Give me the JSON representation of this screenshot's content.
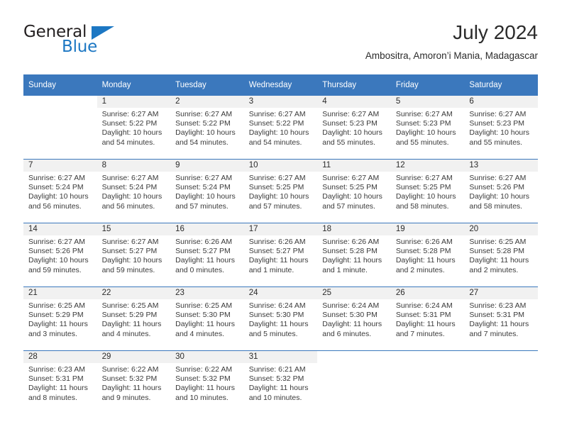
{
  "brand": {
    "word_one": "General",
    "word_two": "Blue",
    "triangle_icon": "brand-triangle-icon",
    "accent_color": "#1c77c3"
  },
  "header": {
    "title": "July 2024",
    "subtitle": "Ambositra, Amoron’i Mania, Madagascar"
  },
  "theme": {
    "header_blue": "#3b78bd",
    "daynum_band": "#f1f1f1",
    "text": "#2b2b2b"
  },
  "weekday_headers": [
    "Sunday",
    "Monday",
    "Tuesday",
    "Wednesday",
    "Thursday",
    "Friday",
    "Saturday"
  ],
  "weeks": [
    [
      {
        "day": "",
        "blank": true,
        "sunrise": "",
        "sunset": "",
        "daylight_line1": "",
        "daylight_line2": ""
      },
      {
        "day": "1",
        "sunrise": "Sunrise: 6:27 AM",
        "sunset": "Sunset: 5:22 PM",
        "daylight_line1": "Daylight: 10 hours",
        "daylight_line2": "and 54 minutes."
      },
      {
        "day": "2",
        "sunrise": "Sunrise: 6:27 AM",
        "sunset": "Sunset: 5:22 PM",
        "daylight_line1": "Daylight: 10 hours",
        "daylight_line2": "and 54 minutes."
      },
      {
        "day": "3",
        "sunrise": "Sunrise: 6:27 AM",
        "sunset": "Sunset: 5:22 PM",
        "daylight_line1": "Daylight: 10 hours",
        "daylight_line2": "and 54 minutes."
      },
      {
        "day": "4",
        "sunrise": "Sunrise: 6:27 AM",
        "sunset": "Sunset: 5:23 PM",
        "daylight_line1": "Daylight: 10 hours",
        "daylight_line2": "and 55 minutes."
      },
      {
        "day": "5",
        "sunrise": "Sunrise: 6:27 AM",
        "sunset": "Sunset: 5:23 PM",
        "daylight_line1": "Daylight: 10 hours",
        "daylight_line2": "and 55 minutes."
      },
      {
        "day": "6",
        "sunrise": "Sunrise: 6:27 AM",
        "sunset": "Sunset: 5:23 PM",
        "daylight_line1": "Daylight: 10 hours",
        "daylight_line2": "and 55 minutes."
      }
    ],
    [
      {
        "day": "7",
        "sunrise": "Sunrise: 6:27 AM",
        "sunset": "Sunset: 5:24 PM",
        "daylight_line1": "Daylight: 10 hours",
        "daylight_line2": "and 56 minutes."
      },
      {
        "day": "8",
        "sunrise": "Sunrise: 6:27 AM",
        "sunset": "Sunset: 5:24 PM",
        "daylight_line1": "Daylight: 10 hours",
        "daylight_line2": "and 56 minutes."
      },
      {
        "day": "9",
        "sunrise": "Sunrise: 6:27 AM",
        "sunset": "Sunset: 5:24 PM",
        "daylight_line1": "Daylight: 10 hours",
        "daylight_line2": "and 57 minutes."
      },
      {
        "day": "10",
        "sunrise": "Sunrise: 6:27 AM",
        "sunset": "Sunset: 5:25 PM",
        "daylight_line1": "Daylight: 10 hours",
        "daylight_line2": "and 57 minutes."
      },
      {
        "day": "11",
        "sunrise": "Sunrise: 6:27 AM",
        "sunset": "Sunset: 5:25 PM",
        "daylight_line1": "Daylight: 10 hours",
        "daylight_line2": "and 57 minutes."
      },
      {
        "day": "12",
        "sunrise": "Sunrise: 6:27 AM",
        "sunset": "Sunset: 5:25 PM",
        "daylight_line1": "Daylight: 10 hours",
        "daylight_line2": "and 58 minutes."
      },
      {
        "day": "13",
        "sunrise": "Sunrise: 6:27 AM",
        "sunset": "Sunset: 5:26 PM",
        "daylight_line1": "Daylight: 10 hours",
        "daylight_line2": "and 58 minutes."
      }
    ],
    [
      {
        "day": "14",
        "sunrise": "Sunrise: 6:27 AM",
        "sunset": "Sunset: 5:26 PM",
        "daylight_line1": "Daylight: 10 hours",
        "daylight_line2": "and 59 minutes."
      },
      {
        "day": "15",
        "sunrise": "Sunrise: 6:27 AM",
        "sunset": "Sunset: 5:27 PM",
        "daylight_line1": "Daylight: 10 hours",
        "daylight_line2": "and 59 minutes."
      },
      {
        "day": "16",
        "sunrise": "Sunrise: 6:26 AM",
        "sunset": "Sunset: 5:27 PM",
        "daylight_line1": "Daylight: 11 hours",
        "daylight_line2": "and 0 minutes."
      },
      {
        "day": "17",
        "sunrise": "Sunrise: 6:26 AM",
        "sunset": "Sunset: 5:27 PM",
        "daylight_line1": "Daylight: 11 hours",
        "daylight_line2": "and 1 minute."
      },
      {
        "day": "18",
        "sunrise": "Sunrise: 6:26 AM",
        "sunset": "Sunset: 5:28 PM",
        "daylight_line1": "Daylight: 11 hours",
        "daylight_line2": "and 1 minute."
      },
      {
        "day": "19",
        "sunrise": "Sunrise: 6:26 AM",
        "sunset": "Sunset: 5:28 PM",
        "daylight_line1": "Daylight: 11 hours",
        "daylight_line2": "and 2 minutes."
      },
      {
        "day": "20",
        "sunrise": "Sunrise: 6:25 AM",
        "sunset": "Sunset: 5:28 PM",
        "daylight_line1": "Daylight: 11 hours",
        "daylight_line2": "and 2 minutes."
      }
    ],
    [
      {
        "day": "21",
        "sunrise": "Sunrise: 6:25 AM",
        "sunset": "Sunset: 5:29 PM",
        "daylight_line1": "Daylight: 11 hours",
        "daylight_line2": "and 3 minutes."
      },
      {
        "day": "22",
        "sunrise": "Sunrise: 6:25 AM",
        "sunset": "Sunset: 5:29 PM",
        "daylight_line1": "Daylight: 11 hours",
        "daylight_line2": "and 4 minutes."
      },
      {
        "day": "23",
        "sunrise": "Sunrise: 6:25 AM",
        "sunset": "Sunset: 5:30 PM",
        "daylight_line1": "Daylight: 11 hours",
        "daylight_line2": "and 4 minutes."
      },
      {
        "day": "24",
        "sunrise": "Sunrise: 6:24 AM",
        "sunset": "Sunset: 5:30 PM",
        "daylight_line1": "Daylight: 11 hours",
        "daylight_line2": "and 5 minutes."
      },
      {
        "day": "25",
        "sunrise": "Sunrise: 6:24 AM",
        "sunset": "Sunset: 5:30 PM",
        "daylight_line1": "Daylight: 11 hours",
        "daylight_line2": "and 6 minutes."
      },
      {
        "day": "26",
        "sunrise": "Sunrise: 6:24 AM",
        "sunset": "Sunset: 5:31 PM",
        "daylight_line1": "Daylight: 11 hours",
        "daylight_line2": "and 7 minutes."
      },
      {
        "day": "27",
        "sunrise": "Sunrise: 6:23 AM",
        "sunset": "Sunset: 5:31 PM",
        "daylight_line1": "Daylight: 11 hours",
        "daylight_line2": "and 7 minutes."
      }
    ],
    [
      {
        "day": "28",
        "sunrise": "Sunrise: 6:23 AM",
        "sunset": "Sunset: 5:31 PM",
        "daylight_line1": "Daylight: 11 hours",
        "daylight_line2": "and 8 minutes."
      },
      {
        "day": "29",
        "sunrise": "Sunrise: 6:22 AM",
        "sunset": "Sunset: 5:32 PM",
        "daylight_line1": "Daylight: 11 hours",
        "daylight_line2": "and 9 minutes."
      },
      {
        "day": "30",
        "sunrise": "Sunrise: 6:22 AM",
        "sunset": "Sunset: 5:32 PM",
        "daylight_line1": "Daylight: 11 hours",
        "daylight_line2": "and 10 minutes."
      },
      {
        "day": "31",
        "sunrise": "Sunrise: 6:21 AM",
        "sunset": "Sunset: 5:32 PM",
        "daylight_line1": "Daylight: 11 hours",
        "daylight_line2": "and 10 minutes."
      },
      {
        "day": "",
        "blank": true,
        "sunrise": "",
        "sunset": "",
        "daylight_line1": "",
        "daylight_line2": ""
      },
      {
        "day": "",
        "blank": true,
        "sunrise": "",
        "sunset": "",
        "daylight_line1": "",
        "daylight_line2": ""
      },
      {
        "day": "",
        "blank": true,
        "sunrise": "",
        "sunset": "",
        "daylight_line1": "",
        "daylight_line2": ""
      }
    ]
  ]
}
